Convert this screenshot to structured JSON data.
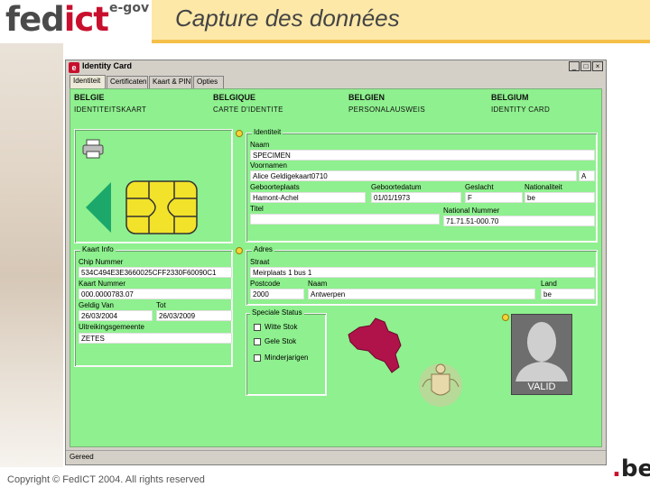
{
  "header": {
    "brand_left": "fed",
    "brand_right": "ict",
    "brand_suffix": "e-gov",
    "slide_title": "Capture des données"
  },
  "window": {
    "title": "Identity Card",
    "min": "_",
    "max": "□",
    "close": "×",
    "status": "Gereed",
    "tabs": [
      "Identiteit",
      "Certificaten",
      "Kaart & PIN",
      "Opties"
    ]
  },
  "card_headers": [
    {
      "country": "BELGIE",
      "doc": "IDENTITEITSKAART"
    },
    {
      "country": "BELGIQUE",
      "doc": "CARTE D'IDENTITE"
    },
    {
      "country": "BELGIEN",
      "doc": "PERSONALAUSWEIS"
    },
    {
      "country": "BELGIUM",
      "doc": "IDENTITY CARD"
    }
  ],
  "identity": {
    "legend": "Identiteit",
    "naam_label": "Naam",
    "naam": "SPECIMEN",
    "voornamen_label": "Voornamen",
    "voornamen": "Alice Geldigekaart0710",
    "initial": "A",
    "geboorteplaats_label": "Geboorteplaats",
    "geboorteplaats": "Hamont-Achel",
    "geboortedatum_label": "Geboortedatum",
    "geboortedatum": "01/01/1973",
    "geslacht_label": "Geslacht",
    "geslacht": "F",
    "nationaliteit_label": "Nationaliteit",
    "nationaliteit": "be",
    "titel_label": "Titel",
    "titel": "",
    "rijksregister_label": "National Nummer",
    "rijksregister": "71.71.51-000.70"
  },
  "card_info": {
    "legend": "Kaart Info",
    "chip_label": "Chip Nummer",
    "chip": "534C494E3E3660025CFF2330F60090C1",
    "kaart_label": "Kaart Nummer",
    "kaart": "000.0000783.07",
    "geldig_van_label": "Geldig Van",
    "geldig_van": "26/03/2004",
    "tot_label": "Tot",
    "tot": "26/03/2009",
    "gemeente_label": "Uitreikingsgemeente",
    "gemeente": "ZETES"
  },
  "address": {
    "legend": "Adres",
    "straat_label": "Straat",
    "straat": "Meirplaats 1 bus 1",
    "postcode_label": "Postcode",
    "postcode": "2000",
    "plaats_label": "Naam",
    "plaats": "Antwerpen",
    "land_label": "Land",
    "land": "be"
  },
  "special_status": {
    "legend": "Speciale Status",
    "options": [
      "Witte Stok",
      "Gele Stok",
      "Minderjarigen"
    ]
  },
  "photo": {
    "status": "VALID"
  },
  "footer": {
    "copyright": "Copyright © FedICT 2004. All rights reserved",
    "be_logo": ".be"
  },
  "colors": {
    "panel_green": "#8ef08e",
    "brand_red": "#c8102e",
    "title_band": "#fde8a8",
    "map_red": "#b0124a"
  }
}
